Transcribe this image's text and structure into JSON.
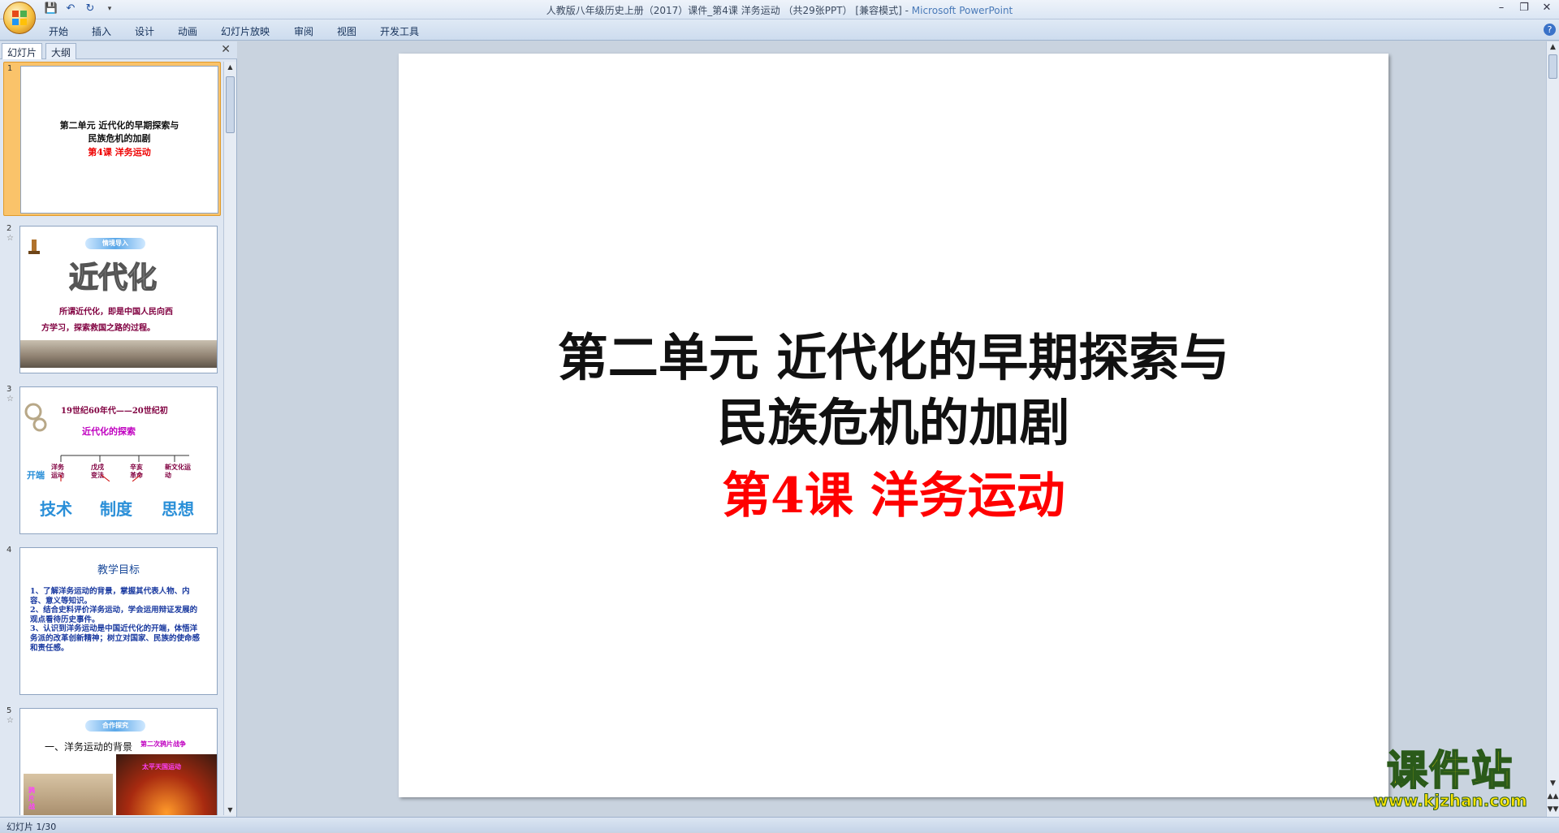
{
  "window": {
    "title": "人教版八年级历史上册（2017）课件_第4课 洋务运动 （共29张PPT） [兼容模式]",
    "app_name": "Microsoft PowerPoint"
  },
  "ribbon_tabs": [
    "开始",
    "插入",
    "设计",
    "动画",
    "幻灯片放映",
    "审阅",
    "视图",
    "开发工具"
  ],
  "pane_tabs": {
    "slides": "幻灯片",
    "outline": "大纲"
  },
  "thumbnails": [
    {
      "num": "1",
      "lines": [
        "第二单元  近代化的早期探索与",
        "民族危机的加剧"
      ],
      "sub": "第4课  洋务运动"
    },
    {
      "num": "2",
      "badge": "情境导入",
      "big": "近代化",
      "lines": [
        "所谓近代化，即是中国人民向西",
        "方学习，探索救国之路的过程。"
      ]
    },
    {
      "num": "3",
      "header": "19世纪60年代——20世纪初",
      "title": "近代化的探索",
      "start": "开端",
      "items": [
        "洋务运动",
        "戊戌变法",
        "辛亥革命",
        "新文化运动"
      ],
      "words": [
        "技术",
        "制度",
        "思想"
      ]
    },
    {
      "num": "4",
      "title": "教学目标",
      "lines": [
        "1、了解洋务运动的背景，掌握其代表人物、内容、意义等知识。",
        "2、结合史料评价洋务运动，学会运用辩证发展的观点看待历史事件。",
        "3、认识到洋务运动是中国近代化的开端，体悟洋务派的改革创新精神；树立对国家、民族的使命感和责任感。"
      ]
    },
    {
      "num": "5",
      "badge": "合作探究",
      "line": "一、洋务运动的背景",
      "tag1": "第二次鸦片战争",
      "tag2": "太平天国运动",
      "tag3": "鸦片战"
    }
  ],
  "slide": {
    "title_line1": "第二单元  近代化的早期探索与",
    "title_line2": "民族危机的加剧",
    "subtitle": "第4课  洋务运动",
    "title_color": "#111111",
    "subtitle_color": "#ff0000"
  },
  "status": {
    "slide_indicator": "幻灯片 1/30"
  },
  "watermark": {
    "text": "课件站",
    "url": "www.kjzhan.com"
  }
}
